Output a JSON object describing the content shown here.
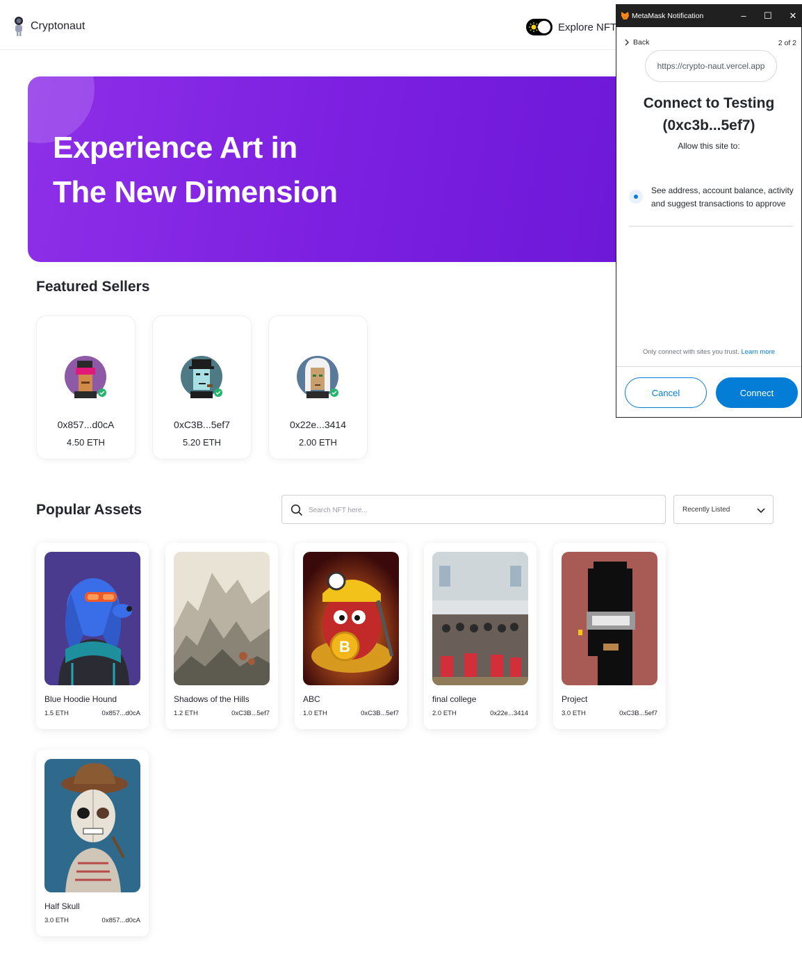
{
  "app": {
    "name": "Cryptonaut"
  },
  "navbar": {
    "explore_label": "Explore NFTs"
  },
  "hero": {
    "line1": "Experience Art in",
    "line2": "The New Dimension"
  },
  "featured": {
    "title": "Featured Sellers",
    "sellers": [
      {
        "address": "0x857...d0cA",
        "balance": "4.50 ETH"
      },
      {
        "address": "0xC3B...5ef7",
        "balance": "5.20 ETH"
      },
      {
        "address": "0x22e...3414",
        "balance": "2.00 ETH"
      }
    ]
  },
  "popular": {
    "title": "Popular Assets",
    "search_placeholder": "Search NFT here...",
    "sort_selected": "Recently Listed",
    "assets": [
      {
        "name": "Blue Hoodie Hound",
        "price": "1.5 ETH",
        "owner": "0x857...d0cA"
      },
      {
        "name": "Shadows of the Hills",
        "price": "1.2 ETH",
        "owner": "0xC3B...5ef7"
      },
      {
        "name": "ABC",
        "price": "1.0 ETH",
        "owner": "0xC3B...5ef7"
      },
      {
        "name": "final college",
        "price": "2.0 ETH",
        "owner": "0x22e...3414"
      },
      {
        "name": "Project",
        "price": "3.0 ETH",
        "owner": "0xC3B...5ef7"
      },
      {
        "name": "Half Skull",
        "price": "3.0 ETH",
        "owner": "0x857...d0cA"
      }
    ]
  },
  "metamask": {
    "window_title": "MetaMask Notification",
    "back_label": "Back",
    "page_indicator": "2 of 2",
    "site_url": "https://crypto-naut.vercel.app",
    "heading_line1": "Connect to Testing",
    "heading_line2": "(0xc3b...5ef7)",
    "allow_text": "Allow this site to:",
    "permission_text": "See address, account balance, activity and suggest transactions to approve",
    "trust_text": "Only connect with sites you trust.",
    "learn_more": "Learn more",
    "cancel_label": "Cancel",
    "connect_label": "Connect"
  },
  "colors": {
    "hero_gradient_start": "#8e2fe8",
    "hero_gradient_end": "#6d18d8",
    "metamask_blue": "#037dd6",
    "titlebar": "#202020"
  }
}
